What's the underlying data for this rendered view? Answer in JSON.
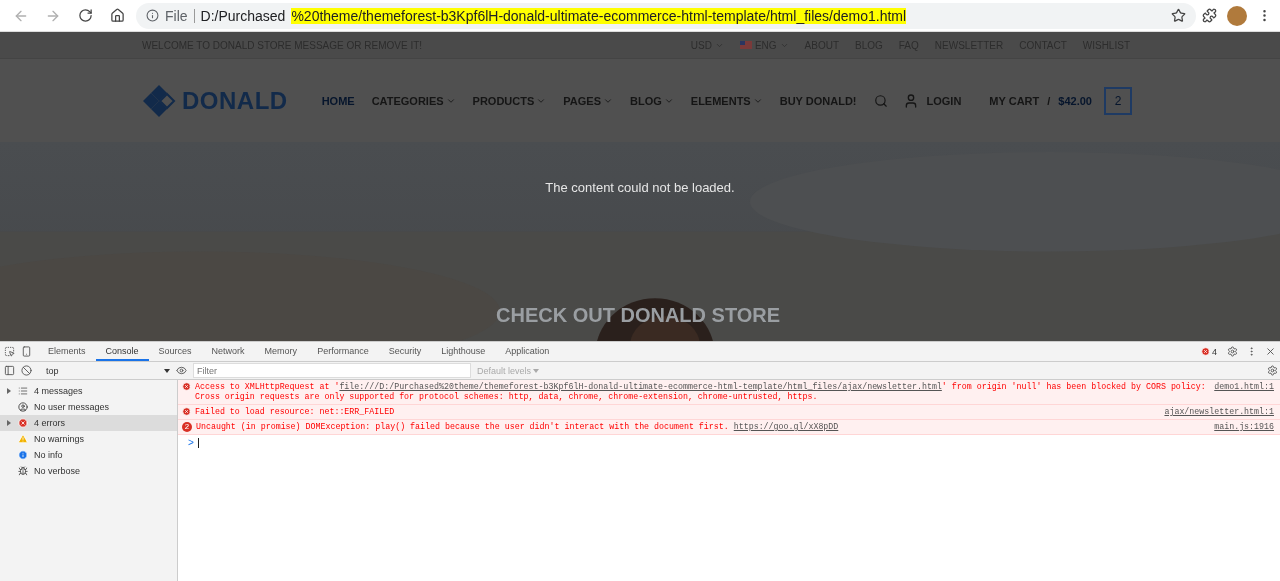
{
  "browser": {
    "url_prefix": "D:/Purchased",
    "url_highlight": "%20theme/themeforest-b3Kpf6lH-donald-ultimate-ecommerce-html-template/html_files/demo1.html",
    "scheme": "File"
  },
  "site": {
    "welcome": "WELCOME TO DONALD STORE MESSAGE OR REMOVE IT!",
    "top_links": [
      {
        "label": "USD",
        "kind": "dropdown"
      },
      {
        "label": "ENG",
        "kind": "language"
      },
      {
        "label": "ABOUT",
        "kind": "link"
      },
      {
        "label": "BLOG",
        "kind": "link"
      },
      {
        "label": "FAQ",
        "kind": "link"
      },
      {
        "label": "NEWSLETTER",
        "kind": "link"
      },
      {
        "label": "CONTACT",
        "kind": "link"
      },
      {
        "label": "WISHLIST",
        "kind": "link"
      }
    ],
    "logo": "DONALD",
    "nav": [
      {
        "label": "HOME",
        "selected": true,
        "dropdown": false
      },
      {
        "label": "CATEGORIES",
        "selected": false,
        "dropdown": true
      },
      {
        "label": "PRODUCTS",
        "selected": false,
        "dropdown": true
      },
      {
        "label": "PAGES",
        "selected": false,
        "dropdown": true
      },
      {
        "label": "BLOG",
        "selected": false,
        "dropdown": true
      },
      {
        "label": "ELEMENTS",
        "selected": false,
        "dropdown": true
      },
      {
        "label": "BUY DONALD!",
        "selected": false,
        "dropdown": false
      }
    ],
    "login": "LOGIN",
    "cart_label": "MY CART",
    "cart_sep": "/",
    "cart_total": "$42.00",
    "cart_count": "2",
    "hero": {
      "kind": "picture",
      "message": "The content could not be loaded.",
      "headline": "CHECK OUT DONALD STORE"
    }
  },
  "devtools": {
    "tabs": [
      {
        "label": "Elements",
        "selected": false
      },
      {
        "label": "Console",
        "selected": true
      },
      {
        "label": "Sources",
        "selected": false
      },
      {
        "label": "Network",
        "selected": false
      },
      {
        "label": "Memory",
        "selected": false
      },
      {
        "label": "Performance",
        "selected": false
      },
      {
        "label": "Security",
        "selected": false
      },
      {
        "label": "Lighthouse",
        "selected": false
      },
      {
        "label": "Application",
        "selected": false
      }
    ],
    "error_count": "4",
    "context": "top",
    "filter_placeholder": "Filter",
    "levels": "Default levels",
    "sidebar": [
      {
        "label": "4 messages",
        "kind": "list",
        "expandable": true,
        "selected": false
      },
      {
        "label": "No user messages",
        "kind": "user",
        "expandable": false,
        "selected": false
      },
      {
        "label": "4 errors",
        "kind": "error",
        "expandable": true,
        "selected": true
      },
      {
        "label": "No warnings",
        "kind": "warning",
        "expandable": false,
        "selected": false
      },
      {
        "label": "No info",
        "kind": "info",
        "expandable": false,
        "selected": false
      },
      {
        "label": "No verbose",
        "kind": "verbose",
        "expandable": false,
        "selected": false
      }
    ],
    "messages": [
      {
        "before": "Access to XMLHttpRequest at '",
        "link": "file:///D:/Purchased%20theme/themeforest-b3Kpf6lH-donald-ultimate-ecommerce-html-template/html_files/ajax/newsletter.html",
        "after": "' from origin 'null' has been blocked by CORS policy: Cross origin requests are only supported for protocol schemes: http, data, chrome, chrome-extension, chrome-untrusted, https.",
        "source": "demo1.html:1"
      },
      {
        "before": "Failed to load resource: net::ERR_FAILED",
        "source": "ajax/newsletter.html:1"
      },
      {
        "repeat": "2",
        "before": "Uncaught (in promise) DOMException: play() failed because the user didn't interact with the document first. ",
        "link": "https://goo.gl/xX8pDD",
        "source": "main.js:1916"
      }
    ],
    "prompt": ">"
  }
}
